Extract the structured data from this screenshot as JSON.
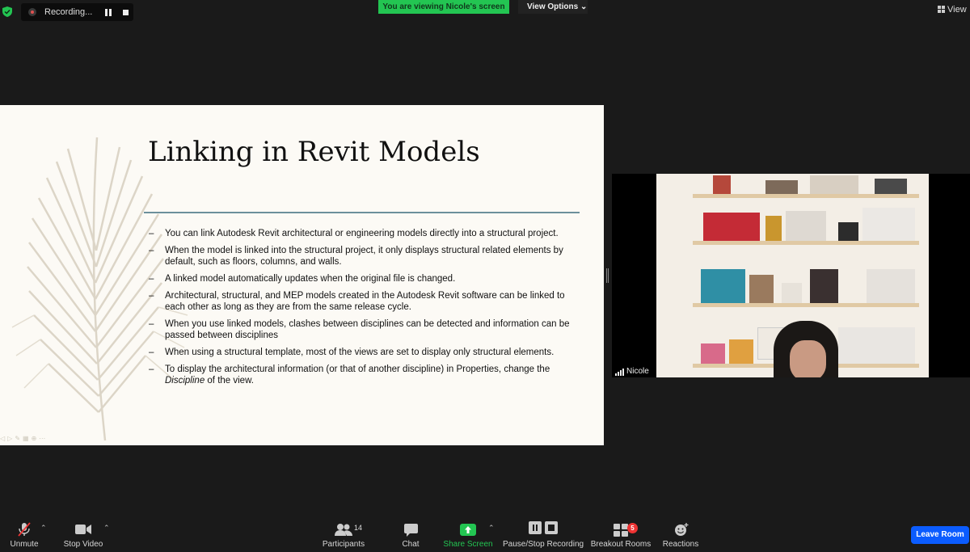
{
  "recording": {
    "label": "Recording..."
  },
  "banner": {
    "viewing": "You are viewing Nicole's screen",
    "view_options": "View Options"
  },
  "view_menu": {
    "label": "View"
  },
  "slide": {
    "title": "Linking in Revit Models",
    "bullets": [
      "You can link Autodesk Revit architectural or engineering models directly into a structural project.",
      "When the model is linked into the structural project, it only displays structural related elements by default, such as floors, columns, and walls.",
      "A linked model automatically updates when the original file is changed.",
      "Architectural, structural, and MEP models created in the Autodesk Revit software can be linked to each other as long as they are from the same release cycle.",
      "When you use linked models, clashes between disciplines can be detected and information can be passed between disciplines",
      "When using a structural template, most of the views are set to display only structural elements."
    ],
    "last_bullet": {
      "before": "To display the architectural information (or that of another discipline) in Properties, change the ",
      "emphasis": "Discipline",
      "after": " of the view."
    },
    "dash": "–"
  },
  "participant_video": {
    "name": "Nicole"
  },
  "toolbar": {
    "unmute": "Unmute",
    "stop_video": "Stop Video",
    "participants": "Participants",
    "participants_count": "14",
    "chat": "Chat",
    "share_screen": "Share Screen",
    "recording": "Pause/Stop Recording",
    "breakout_rooms": "Breakout Rooms",
    "breakout_badge": "5",
    "reactions": "Reactions",
    "leave": "Leave Room"
  },
  "colors": {
    "share_green": "#23c552",
    "leave_blue": "#0b5cff",
    "badge_red": "#e33333",
    "slide_bg": "#fcfaf5",
    "rule": "#6c909b"
  }
}
